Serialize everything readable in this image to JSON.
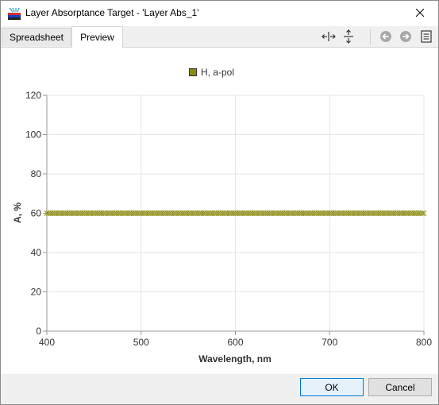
{
  "window": {
    "title": "Layer Absorptance Target - 'Layer Abs_1'",
    "app_icon": "layer-stack-icon",
    "close_icon": "close-icon"
  },
  "tabs": [
    {
      "label": "Spreadsheet",
      "active": false
    },
    {
      "label": "Preview",
      "active": true
    }
  ],
  "toolbar": {
    "icons": [
      "fit-horizontal-icon",
      "fit-vertical-icon",
      "back-icon",
      "forward-icon",
      "notes-icon"
    ]
  },
  "chart_data": {
    "type": "scatter",
    "series": [
      {
        "name": "H, a-pol",
        "color": "#8a8a12",
        "marker": "x",
        "x_start": 400,
        "x_end": 800,
        "x_step": 2,
        "y": 60
      }
    ],
    "xlabel": "Wavelength, nm",
    "ylabel": "A, %",
    "xlim": [
      400,
      800
    ],
    "ylim": [
      0,
      120
    ],
    "xticks": [
      "400",
      "500",
      "600",
      "700",
      "800"
    ],
    "yticks": [
      "0",
      "20",
      "40",
      "60",
      "80",
      "100",
      "120"
    ],
    "grid": true,
    "legend_position": "top-center"
  },
  "buttons": {
    "ok": "OK",
    "cancel": "Cancel"
  }
}
